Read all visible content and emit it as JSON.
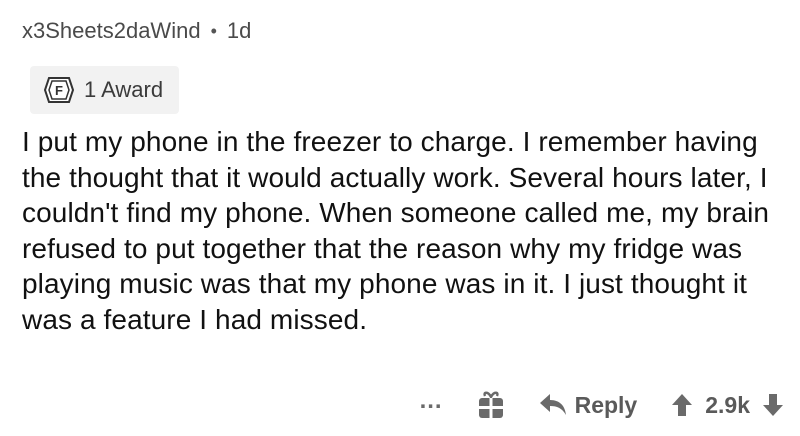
{
  "comment": {
    "author": "x3Sheets2daWind",
    "separator": "•",
    "age": "1d",
    "award": {
      "icon": "award-f-badge-icon",
      "label": "1 Award"
    },
    "body": "I put my phone in the freezer to charge. I remember having the thought that it would actually work. Several hours later, I couldn't find my phone. When someone called me, my brain refused to put together that the reason why my fridge was playing music was that my phone was in it. I just thought it was a feature I had missed.",
    "actions": {
      "more_label": "...",
      "gift_icon": "gift-icon",
      "reply_label": "Reply",
      "score": "2.9k"
    }
  }
}
